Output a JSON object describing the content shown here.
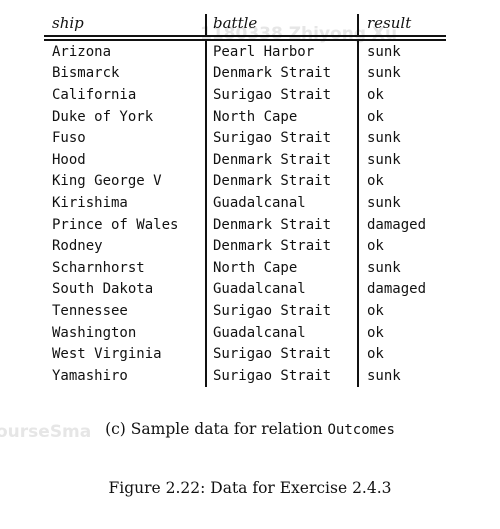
{
  "watermark": {
    "top": "1180338 Zhiyong Xu",
    "left": "ourseSma"
  },
  "table": {
    "headers": [
      "ship",
      "battle",
      "result"
    ],
    "rows": [
      [
        "Arizona",
        "Pearl Harbor",
        "sunk"
      ],
      [
        "Bismarck",
        "Denmark Strait",
        "sunk"
      ],
      [
        "California",
        "Surigao Strait",
        "ok"
      ],
      [
        "Duke of York",
        "North Cape",
        "ok"
      ],
      [
        "Fuso",
        "Surigao Strait",
        "sunk"
      ],
      [
        "Hood",
        "Denmark Strait",
        "sunk"
      ],
      [
        "King George V",
        "Denmark Strait",
        "ok"
      ],
      [
        "Kirishima",
        "Guadalcanal",
        "sunk"
      ],
      [
        "Prince of Wales",
        "Denmark Strait",
        "damaged"
      ],
      [
        "Rodney",
        "Denmark Strait",
        "ok"
      ],
      [
        "Scharnhorst",
        "North Cape",
        "sunk"
      ],
      [
        "South Dakota",
        "Guadalcanal",
        "damaged"
      ],
      [
        "Tennessee",
        "Surigao Strait",
        "ok"
      ],
      [
        "Washington",
        "Guadalcanal",
        "ok"
      ],
      [
        "West Virginia",
        "Surigao Strait",
        "ok"
      ],
      [
        "Yamashiro",
        "Surigao Strait",
        "sunk"
      ]
    ]
  },
  "caption": {
    "prefix": "(c) Sample data for relation ",
    "relation": "Outcomes"
  },
  "figure_caption": "Figure 2.22: Data for Exercise 2.4.3"
}
